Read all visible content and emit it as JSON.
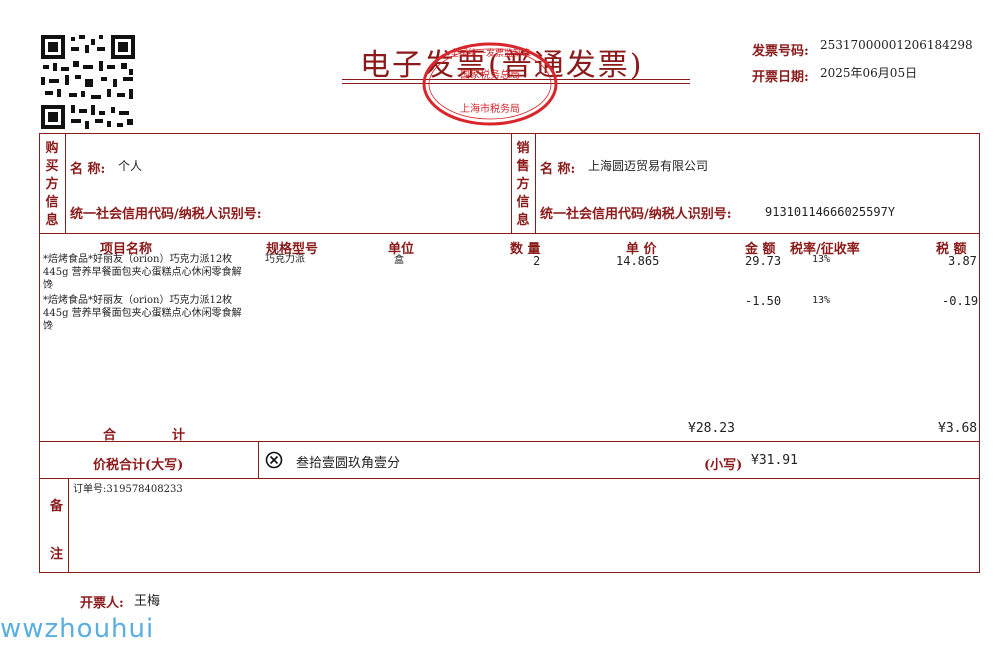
{
  "header": {
    "title": "电子发票(普通发票)",
    "invoice_no_label": "发票号码:",
    "invoice_no": "25317000001206184298",
    "date_label": "开票日期:",
    "date": "2025年06月05日"
  },
  "seal": {
    "text_top": "全国统一发票监制章",
    "text_mid": "国家税务总局",
    "text_bottom": "上海市税务局"
  },
  "buyer": {
    "section_label": "购买方信息",
    "name_label": "名 称:",
    "name": "个人",
    "tax_label": "统一社会信用代码/纳税人识别号:",
    "tax_id": ""
  },
  "seller": {
    "section_label": "销售方信息",
    "name_label": "名 称:",
    "name": "上海圆迈贸易有限公司",
    "tax_label": "统一社会信用代码/纳税人识别号:",
    "tax_id": "91310114666025597Y"
  },
  "items_header": {
    "name": "项目名称",
    "spec": "规格型号",
    "unit": "单位",
    "qty": "数 量",
    "price": "单 价",
    "amount": "金 额",
    "rate": "税率/征收率",
    "tax": "税 额"
  },
  "items": [
    {
      "name_l1": "*焙烤食品*好丽友（orion）巧克力派12枚",
      "name_l2": "445g 营养早餐面包夹心蛋糕点心休闲零食解",
      "name_l3": "馋",
      "spec": "巧克力派",
      "unit": "盒",
      "qty": "2",
      "price": "14.865",
      "amount": "29.73",
      "rate": "13%",
      "tax": "3.87"
    },
    {
      "name_l1": "*焙烤食品*好丽友（orion）巧克力派12枚",
      "name_l2": "445g 营养早餐面包夹心蛋糕点心休闲零食解",
      "name_l3": "馋",
      "spec": "",
      "unit": "",
      "qty": "",
      "price": "",
      "amount": "-1.50",
      "rate": "13%",
      "tax": "-0.19"
    }
  ],
  "totals": {
    "label_a": "合",
    "label_b": "计",
    "amount": "¥28.23",
    "tax": "¥3.68"
  },
  "grand_total": {
    "label": "价税合计(大写)",
    "icon": "circle-x-icon",
    "upper": "叁拾壹圆玖角壹分",
    "small_label": "(小写)",
    "small_value": "¥31.91"
  },
  "remarks": {
    "label_a": "备",
    "label_b": "注",
    "text": "订单号:319578408233"
  },
  "issuer": {
    "label": "开票人:",
    "name": "王梅"
  },
  "watermark": "wwzhouhui",
  "colors": {
    "border": "#8b1a1a",
    "seal": "#d9262c",
    "watermark": "#5aaee0"
  }
}
